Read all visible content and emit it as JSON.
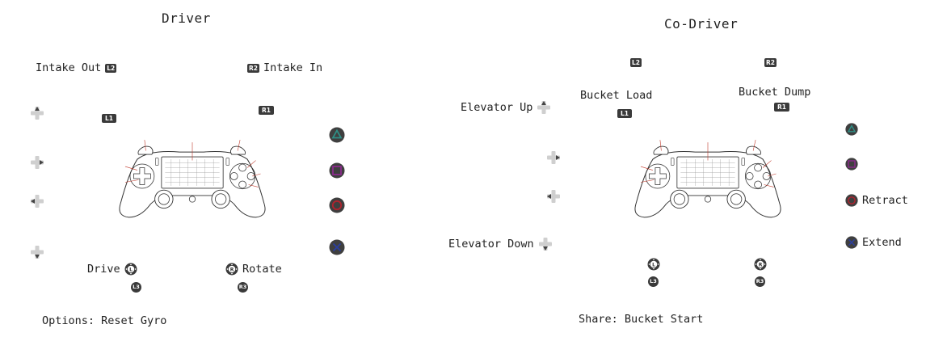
{
  "driver": {
    "title": "Driver",
    "l2_label": "Intake Out",
    "l2_badge": "L2",
    "r2_label": "Intake In",
    "r2_badge": "R2",
    "l1_badge": "L1",
    "r1_badge": "R1",
    "l3_label": "Drive",
    "l3_badge": "L3",
    "r3_label": "Rotate",
    "r3_badge": "R3",
    "options_label": "Options: Reset Gyro"
  },
  "codriver": {
    "title": "Co-Driver",
    "l2_badge": "L2",
    "r2_badge": "R2",
    "l1_label": "Bucket Load",
    "l1_badge": "L1",
    "r1_label": "Bucket Dump",
    "r1_badge": "R1",
    "dpad_up_label": "Elevator Up",
    "dpad_down_label": "Elevator Down",
    "circle_label": "Retract",
    "cross_label": "Extend",
    "l3_badge": "L3",
    "r3_badge": "R3",
    "share_label": "Share: Bucket Start"
  },
  "icons": {
    "dpad": "dpad-icon",
    "triangle": "triangle-button-icon",
    "square": "square-button-icon",
    "circle": "circle-button-icon",
    "cross": "cross-button-icon",
    "stick": "analog-stick-icon",
    "controller": "ps4-controller-illustration"
  },
  "colors": {
    "triangle": "#2e8f86",
    "square": "#8b2a8c",
    "circle": "#b1232e",
    "cross": "#2b3fa0",
    "badge": "#3a3a3a"
  }
}
